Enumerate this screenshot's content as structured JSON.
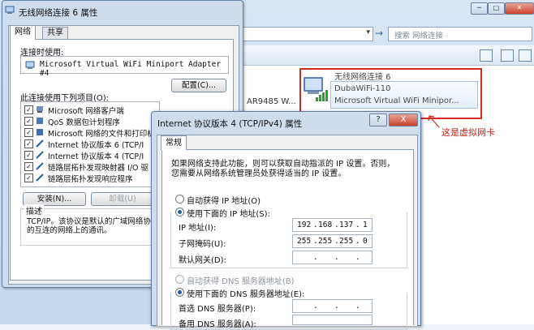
{
  "explorer": {
    "search_placeholder": "搜索 网络连接",
    "partial_item": "AR9485 W...",
    "nav_arrow": "→"
  },
  "network_card": {
    "name": "无线网络连接 6",
    "ssid": "DubaWiFi-110",
    "device": "Microsoft Virtual WiFi Minipor..."
  },
  "annotation": "这是虚拟网卡",
  "dialog1": {
    "title": "无线网络连接 6 属性",
    "tabs": [
      "网络",
      "共享"
    ],
    "connect_using_label": "连接时使用:",
    "adapter": "Microsoft Virtual WiFi Miniport Adapter #4",
    "configure_button": "配置(C)...",
    "items_label": "此连接使用下列项目(O):",
    "items": [
      "Microsoft 网络客户端",
      "QoS 数据包计划程序",
      "Microsoft 网络的文件和打印机",
      "Internet 协议版本 6 (TCP/I",
      "Internet 协议版本 4 (TCP/I",
      "链路层拓扑发现映射器 I/O 驱",
      "链路层拓扑发现响应程序"
    ],
    "install_button": "安装(N)...",
    "uninstall_button": "卸载(U)",
    "description_label": "描述",
    "description_lines": [
      "TCP/IP。该协议是默认的广域网络协",
      "的互连的网络上的通讯。"
    ]
  },
  "dialog2": {
    "title": "Internet 协议版本 4 (TCP/IPv4) 属性",
    "help_button": "?",
    "close_button": "X",
    "tab": "常规",
    "intro_lines": [
      "如果网络支持此功能，则可以获取自动指派的 IP 设置。否则，",
      "您需要从网络系统管理员处获得适当的 IP 设置。"
    ],
    "auto_ip": "自动获得 IP 地址(O)",
    "manual_ip": "使用下面的 IP 地址(S):",
    "ip_label": "IP 地址(I):",
    "ip_value": [
      "192",
      "168",
      "137",
      "1"
    ],
    "mask_label": "子网掩码(U):",
    "mask_value": [
      "255",
      "255",
      "255",
      "0"
    ],
    "gateway_label": "默认网关(D):",
    "auto_dns": "自动获得 DNS 服务器地址(B)",
    "manual_dns": "使用下面的 DNS 服务器地址(E):",
    "preferred_dns_label": "首选 DNS 服务器(P):",
    "alternate_dns_label": "备用 DNS 服务器(A):",
    "dot": "."
  }
}
